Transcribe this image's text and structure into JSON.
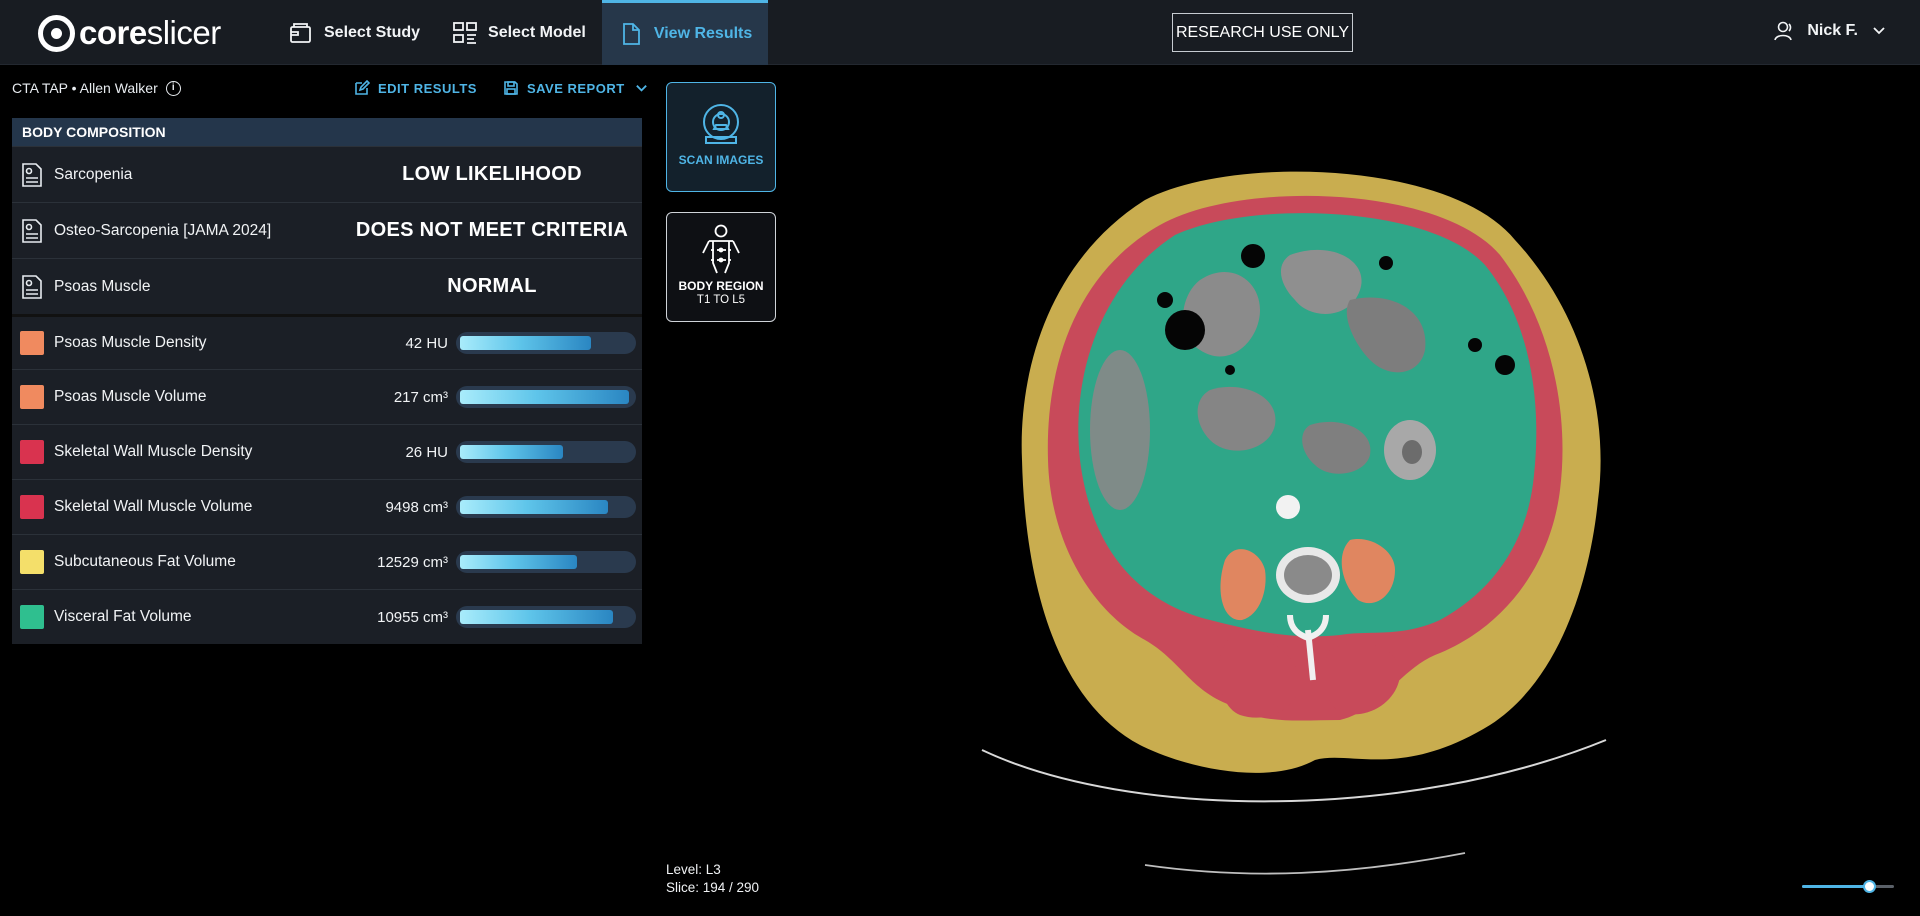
{
  "header": {
    "logo_text_bold": "core",
    "logo_text_light": "slicer",
    "nav": [
      {
        "label": "Select Study",
        "icon": "folder-icon"
      },
      {
        "label": "Select Model",
        "icon": "model-icon"
      },
      {
        "label": "View Results",
        "icon": "document-icon",
        "active": true
      }
    ],
    "badge": "RESEARCH USE ONLY",
    "user_name": "Nick F."
  },
  "study": {
    "description": "CTA TAP • Allen Walker",
    "info_glyph": "i"
  },
  "actions": {
    "edit_label": "EDIT RESULTS",
    "save_label": "SAVE REPORT"
  },
  "body_composition": {
    "heading": "BODY COMPOSITION",
    "assessments": [
      {
        "label": "Sarcopenia",
        "value": "LOW LIKELIHOOD"
      },
      {
        "label": "Osteo-Sarcopenia [JAMA 2024]",
        "value": "DOES NOT MEET CRITERIA"
      },
      {
        "label": "Psoas Muscle",
        "value": "NORMAL"
      }
    ],
    "measurements": [
      {
        "label": "Psoas Muscle Density",
        "value": "42 HU",
        "color": "#f08a5f",
        "fill": 0.76
      },
      {
        "label": "Psoas Muscle Volume",
        "value": "217 cm³",
        "color": "#f08a5f",
        "fill": 0.98
      },
      {
        "label": "Skeletal Wall Muscle Density",
        "value": "26 HU",
        "color": "#d9334f",
        "fill": 0.6
      },
      {
        "label": "Skeletal Wall Muscle Volume",
        "value": "9498 cm³",
        "color": "#d9334f",
        "fill": 0.86
      },
      {
        "label": "Subcutaneous Fat Volume",
        "value": "12529 cm³",
        "color": "#f4df6a",
        "fill": 0.68
      },
      {
        "label": "Visceral Fat Volume",
        "value": "10955 cm³",
        "color": "#2fbf8f",
        "fill": 0.89
      }
    ]
  },
  "side_buttons": {
    "scan_label": "SCAN IMAGES",
    "region_label": "BODY REGION",
    "region_sub": "T1 TO L5"
  },
  "viewer": {
    "level_text": "Level: L3",
    "slice_text": "Slice: 194 / 290",
    "zoom_level": 0.73
  },
  "colors": {
    "accent": "#4fb5e6",
    "subcutaneous_fat": "#c9ad4f",
    "skeletal_muscle": "#c84a5a",
    "visceral_fat": "#2fa688",
    "psoas": "#e08660"
  }
}
